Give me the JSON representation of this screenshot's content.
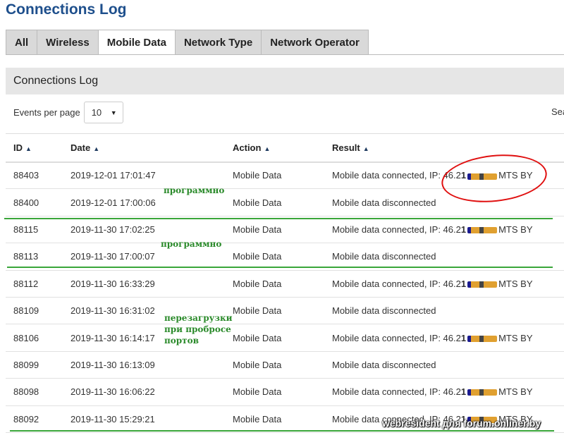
{
  "page": {
    "title": "Connections Log"
  },
  "tabs": [
    {
      "label": "All"
    },
    {
      "label": "Wireless"
    },
    {
      "label": "Mobile Data"
    },
    {
      "label": "Network Type"
    },
    {
      "label": "Network Operator"
    }
  ],
  "panel": {
    "title": "Connections Log"
  },
  "controls": {
    "events_label": "Events per page",
    "events_value": "10",
    "search_label": "Sea"
  },
  "table": {
    "headers": [
      "ID",
      "Date",
      "Action",
      "Result"
    ],
    "rows": [
      {
        "id": "88403",
        "date": "2019-12-01 17:01:47",
        "action": "Mobile Data",
        "result_pre": "Mobile data connected, IP: 46.2",
        "result_post": "MTS BY"
      },
      {
        "id": "88400",
        "date": "2019-12-01 17:00:06",
        "action": "Mobile Data",
        "result_pre": "Mobile data disconnected",
        "result_post": ""
      },
      {
        "id": "88115",
        "date": "2019-11-30 17:02:25",
        "action": "Mobile Data",
        "result_pre": "Mobile data connected, IP: 46.2",
        "result_post": "MTS BY"
      },
      {
        "id": "88113",
        "date": "2019-11-30 17:00:07",
        "action": "Mobile Data",
        "result_pre": "Mobile data disconnected",
        "result_post": ""
      },
      {
        "id": "88112",
        "date": "2019-11-30 16:33:29",
        "action": "Mobile Data",
        "result_pre": "Mobile data connected, IP: 46.2",
        "result_post": "MTS BY"
      },
      {
        "id": "88109",
        "date": "2019-11-30 16:31:02",
        "action": "Mobile Data",
        "result_pre": "Mobile data disconnected",
        "result_post": ""
      },
      {
        "id": "88106",
        "date": "2019-11-30 16:14:17",
        "action": "Mobile Data",
        "result_pre": "Mobile data connected, IP: 46.2",
        "result_post": "MTS BY"
      },
      {
        "id": "88099",
        "date": "2019-11-30 16:13:09",
        "action": "Mobile Data",
        "result_pre": "Mobile data disconnected",
        "result_post": ""
      },
      {
        "id": "88098",
        "date": "2019-11-30 16:06:22",
        "action": "Mobile Data",
        "result_pre": "Mobile data connected, IP: 46.2",
        "result_post": "MTS BY"
      },
      {
        "id": "88092",
        "date": "2019-11-30 15:29:21",
        "action": "Mobile Data",
        "result_pre": "Mobile data connected, IP: 46.2",
        "result_post": "MTS BY"
      }
    ]
  },
  "annotations": {
    "a1": "программно",
    "a2": "программно",
    "a3": [
      "перезагрузки",
      "при пробросе",
      "портов"
    ]
  },
  "watermark": "webresident для forum.onliner.by",
  "colors": {
    "title": "#1e4f8c",
    "annotation": "#2a8a2a",
    "highlight": "#e01010"
  }
}
